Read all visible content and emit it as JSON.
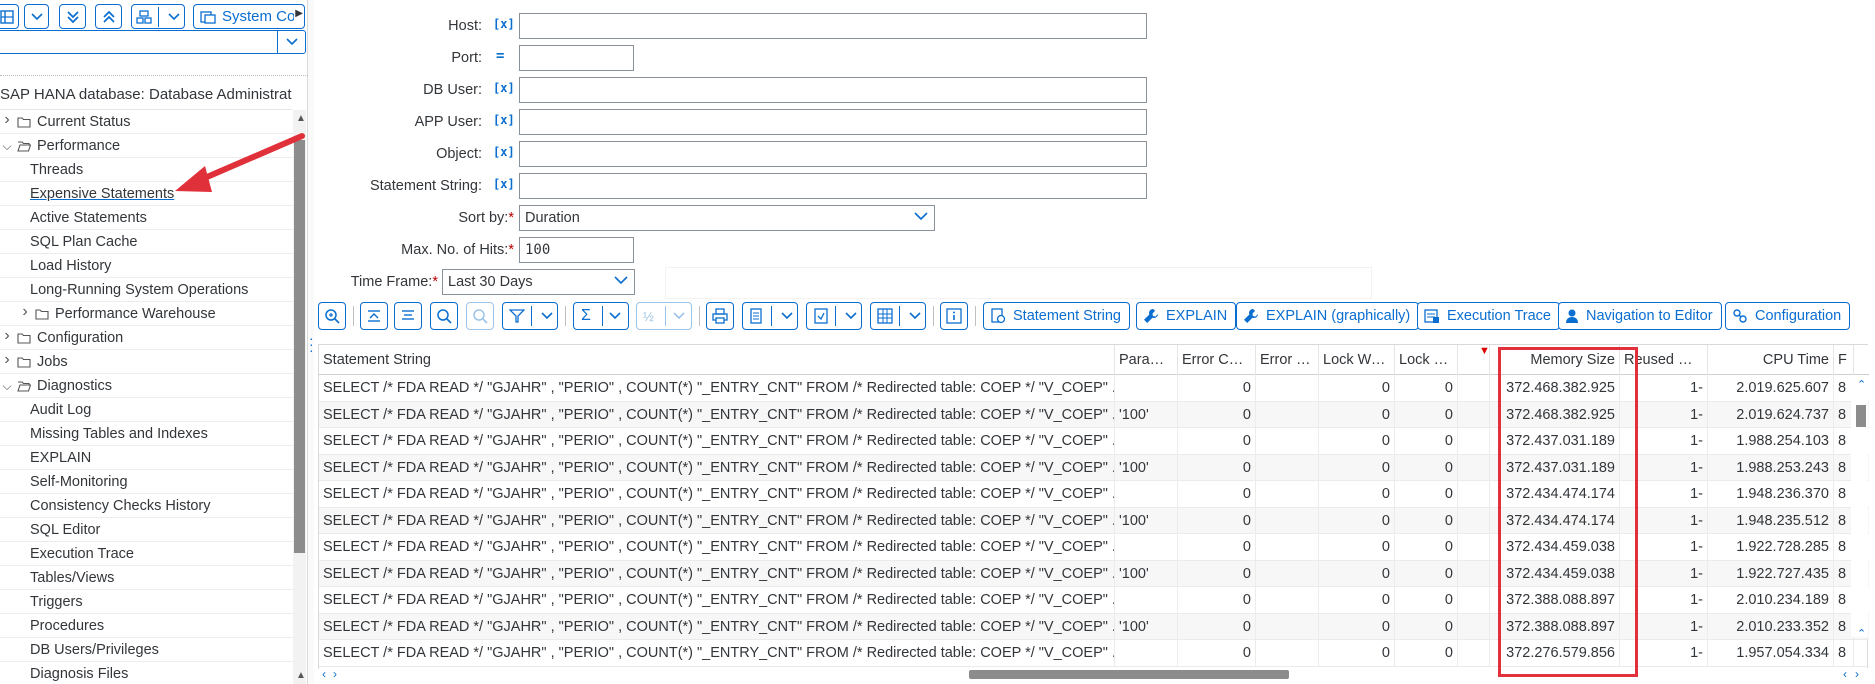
{
  "left_pane": {
    "toolbar": {
      "system_label": "System Co"
    },
    "tree_title": "SAP HANA database: Database Administrati...",
    "items": [
      {
        "label": "Current Status",
        "level": 0,
        "expandable": true,
        "expanded": false
      },
      {
        "label": "Performance",
        "level": 0,
        "expandable": true,
        "expanded": true
      },
      {
        "label": "Threads",
        "level": 1
      },
      {
        "label": "Expensive Statements",
        "level": 1,
        "selected": true
      },
      {
        "label": "Active Statements",
        "level": 1
      },
      {
        "label": "SQL Plan Cache",
        "level": 1
      },
      {
        "label": "Load History",
        "level": 1
      },
      {
        "label": "Long-Running System Operations",
        "level": 1
      },
      {
        "label": "Performance Warehouse",
        "level": 1,
        "expandable": true,
        "expanded": false
      },
      {
        "label": "Configuration",
        "level": 0,
        "expandable": true,
        "expanded": false
      },
      {
        "label": "Jobs",
        "level": 0,
        "expandable": true,
        "expanded": false
      },
      {
        "label": "Diagnostics",
        "level": 0,
        "expandable": true,
        "expanded": true
      },
      {
        "label": "Audit Log",
        "level": 1
      },
      {
        "label": "Missing Tables and Indexes",
        "level": 1
      },
      {
        "label": "EXPLAIN",
        "level": 1
      },
      {
        "label": "Self-Monitoring",
        "level": 1
      },
      {
        "label": "Consistency Checks History",
        "level": 1
      },
      {
        "label": "SQL Editor",
        "level": 1
      },
      {
        "label": "Execution Trace",
        "level": 1
      },
      {
        "label": "Tables/Views",
        "level": 1
      },
      {
        "label": "Triggers",
        "level": 1
      },
      {
        "label": "Procedures",
        "level": 1
      },
      {
        "label": "DB Users/Privileges",
        "level": 1
      },
      {
        "label": "Diagnosis Files",
        "level": 1
      }
    ]
  },
  "filters": {
    "host": {
      "label": "Host:",
      "icon": "[x]",
      "value": ""
    },
    "port": {
      "label": "Port:",
      "icon": "=",
      "value": ""
    },
    "db_user": {
      "label": "DB User:",
      "icon": "[x]",
      "value": ""
    },
    "app_user": {
      "label": "APP User:",
      "icon": "[x]",
      "value": ""
    },
    "object": {
      "label": "Object:",
      "icon": "[x]",
      "value": ""
    },
    "statement_string": {
      "label": "Statement String:",
      "icon": "[x]",
      "value": ""
    },
    "sort_by": {
      "label": "Sort by:",
      "required": "*",
      "value": "Duration"
    },
    "max_hits": {
      "label": "Max. No. of Hits:",
      "required": "*",
      "value": "100"
    },
    "time_frame": {
      "label": "Time Frame:",
      "required": "*",
      "value": "Last 30 Days"
    }
  },
  "toolbar": {
    "icons": [
      "zoom-icon",
      "align-top-icon",
      "align-center-icon",
      "search-icon",
      "search-next-icon",
      "filter-icon",
      "sum-icon",
      "subtotal-icon",
      "print-icon",
      "export-icon",
      "layout-icon",
      "view-icon",
      "info-icon"
    ],
    "buttons": {
      "statement_string": "Statement String",
      "explain": "EXPLAIN",
      "explain_graphically": "EXPLAIN (graphically)",
      "execution_trace": "Execution Trace",
      "navigation_to_editor": "Navigation to Editor",
      "configuration": "Configuration"
    }
  },
  "table": {
    "columns": [
      "Statement String",
      "Paramete...",
      "Error Code",
      "Error Te...",
      "Lock Waits",
      "Lock W...",
      "Memory Size",
      "Reused Mem",
      "CPU Time",
      "F"
    ],
    "rows": [
      {
        "statement": "SELECT /* FDA READ */ \"GJAHR\" , \"PERIO\" , COUNT(*) \"_ENTRY_CNT\" FROM /* Redirected table: COEP */ \"V_COEP\" ...",
        "param": "",
        "error_code": "0",
        "lock_waits": "0",
        "lock_w": "0",
        "memory_size": "372.468.382.925",
        "reused_mem": "1-",
        "cpu_time": "2.019.625.607",
        "f": "8"
      },
      {
        "statement": "SELECT /* FDA READ */ \"GJAHR\" , \"PERIO\" , COUNT(*) \"_ENTRY_CNT\" FROM /* Redirected table: COEP */ \"V_COEP\" ...",
        "param": "'100'",
        "error_code": "0",
        "lock_waits": "0",
        "lock_w": "0",
        "memory_size": "372.468.382.925",
        "reused_mem": "1-",
        "cpu_time": "2.019.624.737",
        "f": "8"
      },
      {
        "statement": "SELECT /* FDA READ */ \"GJAHR\" , \"PERIO\" , COUNT(*) \"_ENTRY_CNT\" FROM /* Redirected table: COEP */ \"V_COEP\" ...",
        "param": "",
        "error_code": "0",
        "lock_waits": "0",
        "lock_w": "0",
        "memory_size": "372.437.031.189",
        "reused_mem": "1-",
        "cpu_time": "1.988.254.103",
        "f": "8"
      },
      {
        "statement": "SELECT /* FDA READ */ \"GJAHR\" , \"PERIO\" , COUNT(*) \"_ENTRY_CNT\" FROM /* Redirected table: COEP */ \"V_COEP\" ...",
        "param": "'100'",
        "error_code": "0",
        "lock_waits": "0",
        "lock_w": "0",
        "memory_size": "372.437.031.189",
        "reused_mem": "1-",
        "cpu_time": "1.988.253.243",
        "f": "8"
      },
      {
        "statement": "SELECT /* FDA READ */ \"GJAHR\" , \"PERIO\" , COUNT(*) \"_ENTRY_CNT\" FROM /* Redirected table: COEP */ \"V_COEP\" ...",
        "param": "",
        "error_code": "0",
        "lock_waits": "0",
        "lock_w": "0",
        "memory_size": "372.434.474.174",
        "reused_mem": "1-",
        "cpu_time": "1.948.236.370",
        "f": "8"
      },
      {
        "statement": "SELECT /* FDA READ */ \"GJAHR\" , \"PERIO\" , COUNT(*) \"_ENTRY_CNT\" FROM /* Redirected table: COEP */ \"V_COEP\" ...",
        "param": "'100'",
        "error_code": "0",
        "lock_waits": "0",
        "lock_w": "0",
        "memory_size": "372.434.474.174",
        "reused_mem": "1-",
        "cpu_time": "1.948.235.512",
        "f": "8"
      },
      {
        "statement": "SELECT /* FDA READ */ \"GJAHR\" , \"PERIO\" , COUNT(*) \"_ENTRY_CNT\" FROM /* Redirected table: COEP */ \"V_COEP\" ...",
        "param": "",
        "error_code": "0",
        "lock_waits": "0",
        "lock_w": "0",
        "memory_size": "372.434.459.038",
        "reused_mem": "1-",
        "cpu_time": "1.922.728.285",
        "f": "8"
      },
      {
        "statement": "SELECT /* FDA READ */ \"GJAHR\" , \"PERIO\" , COUNT(*) \"_ENTRY_CNT\" FROM /* Redirected table: COEP */ \"V_COEP\" ...",
        "param": "'100'",
        "error_code": "0",
        "lock_waits": "0",
        "lock_w": "0",
        "memory_size": "372.434.459.038",
        "reused_mem": "1-",
        "cpu_time": "1.922.727.435",
        "f": "8"
      },
      {
        "statement": "SELECT /* FDA READ */ \"GJAHR\" , \"PERIO\" , COUNT(*) \"_ENTRY_CNT\" FROM /* Redirected table: COEP */ \"V_COEP\" ...",
        "param": "",
        "error_code": "0",
        "lock_waits": "0",
        "lock_w": "0",
        "memory_size": "372.388.088.897",
        "reused_mem": "1-",
        "cpu_time": "2.010.234.189",
        "f": "8"
      },
      {
        "statement": "SELECT /* FDA READ */ \"GJAHR\" , \"PERIO\" , COUNT(*) \"_ENTRY_CNT\" FROM /* Redirected table: COEP */ \"V_COEP\" ...",
        "param": "'100'",
        "error_code": "0",
        "lock_waits": "0",
        "lock_w": "0",
        "memory_size": "372.388.088.897",
        "reused_mem": "1-",
        "cpu_time": "2.010.233.352",
        "f": "8"
      },
      {
        "statement": "SELECT /* FDA READ */ \"GJAHR\" , \"PERIO\" , COUNT(*) \"_ENTRY_CNT\" FROM /* Redirected table: COEP */ \"V_COEP\" ...",
        "param": "",
        "error_code": "0",
        "lock_waits": "0",
        "lock_w": "0",
        "memory_size": "372.276.579.856",
        "reused_mem": "1-",
        "cpu_time": "1.957.054.334",
        "f": "8"
      }
    ]
  },
  "colors": {
    "accent": "#0a6ed1",
    "highlight": "#e0303a",
    "required": "#bb0000"
  }
}
